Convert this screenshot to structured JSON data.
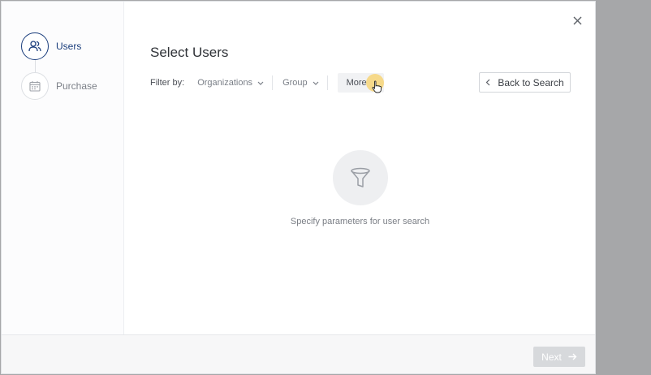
{
  "sidebar": {
    "steps": [
      {
        "label": "Users",
        "icon": "users-icon",
        "state": "active"
      },
      {
        "label": "Purchase",
        "icon": "calendar-icon",
        "state": "inactive"
      }
    ]
  },
  "header": {
    "title": "Select Users"
  },
  "filters": {
    "label": "Filter by:",
    "organizations": "Organizations",
    "group": "Group",
    "more": "More"
  },
  "back_button": {
    "label": "Back to Search"
  },
  "empty_state": {
    "icon": "funnel-icon",
    "message": "Specify parameters for user search"
  },
  "footer": {
    "next_label": "Next",
    "next_enabled": false
  },
  "colors": {
    "accent": "#1a3d7c",
    "backdrop": "#a6a7a9",
    "highlight": "#f6d67e"
  }
}
